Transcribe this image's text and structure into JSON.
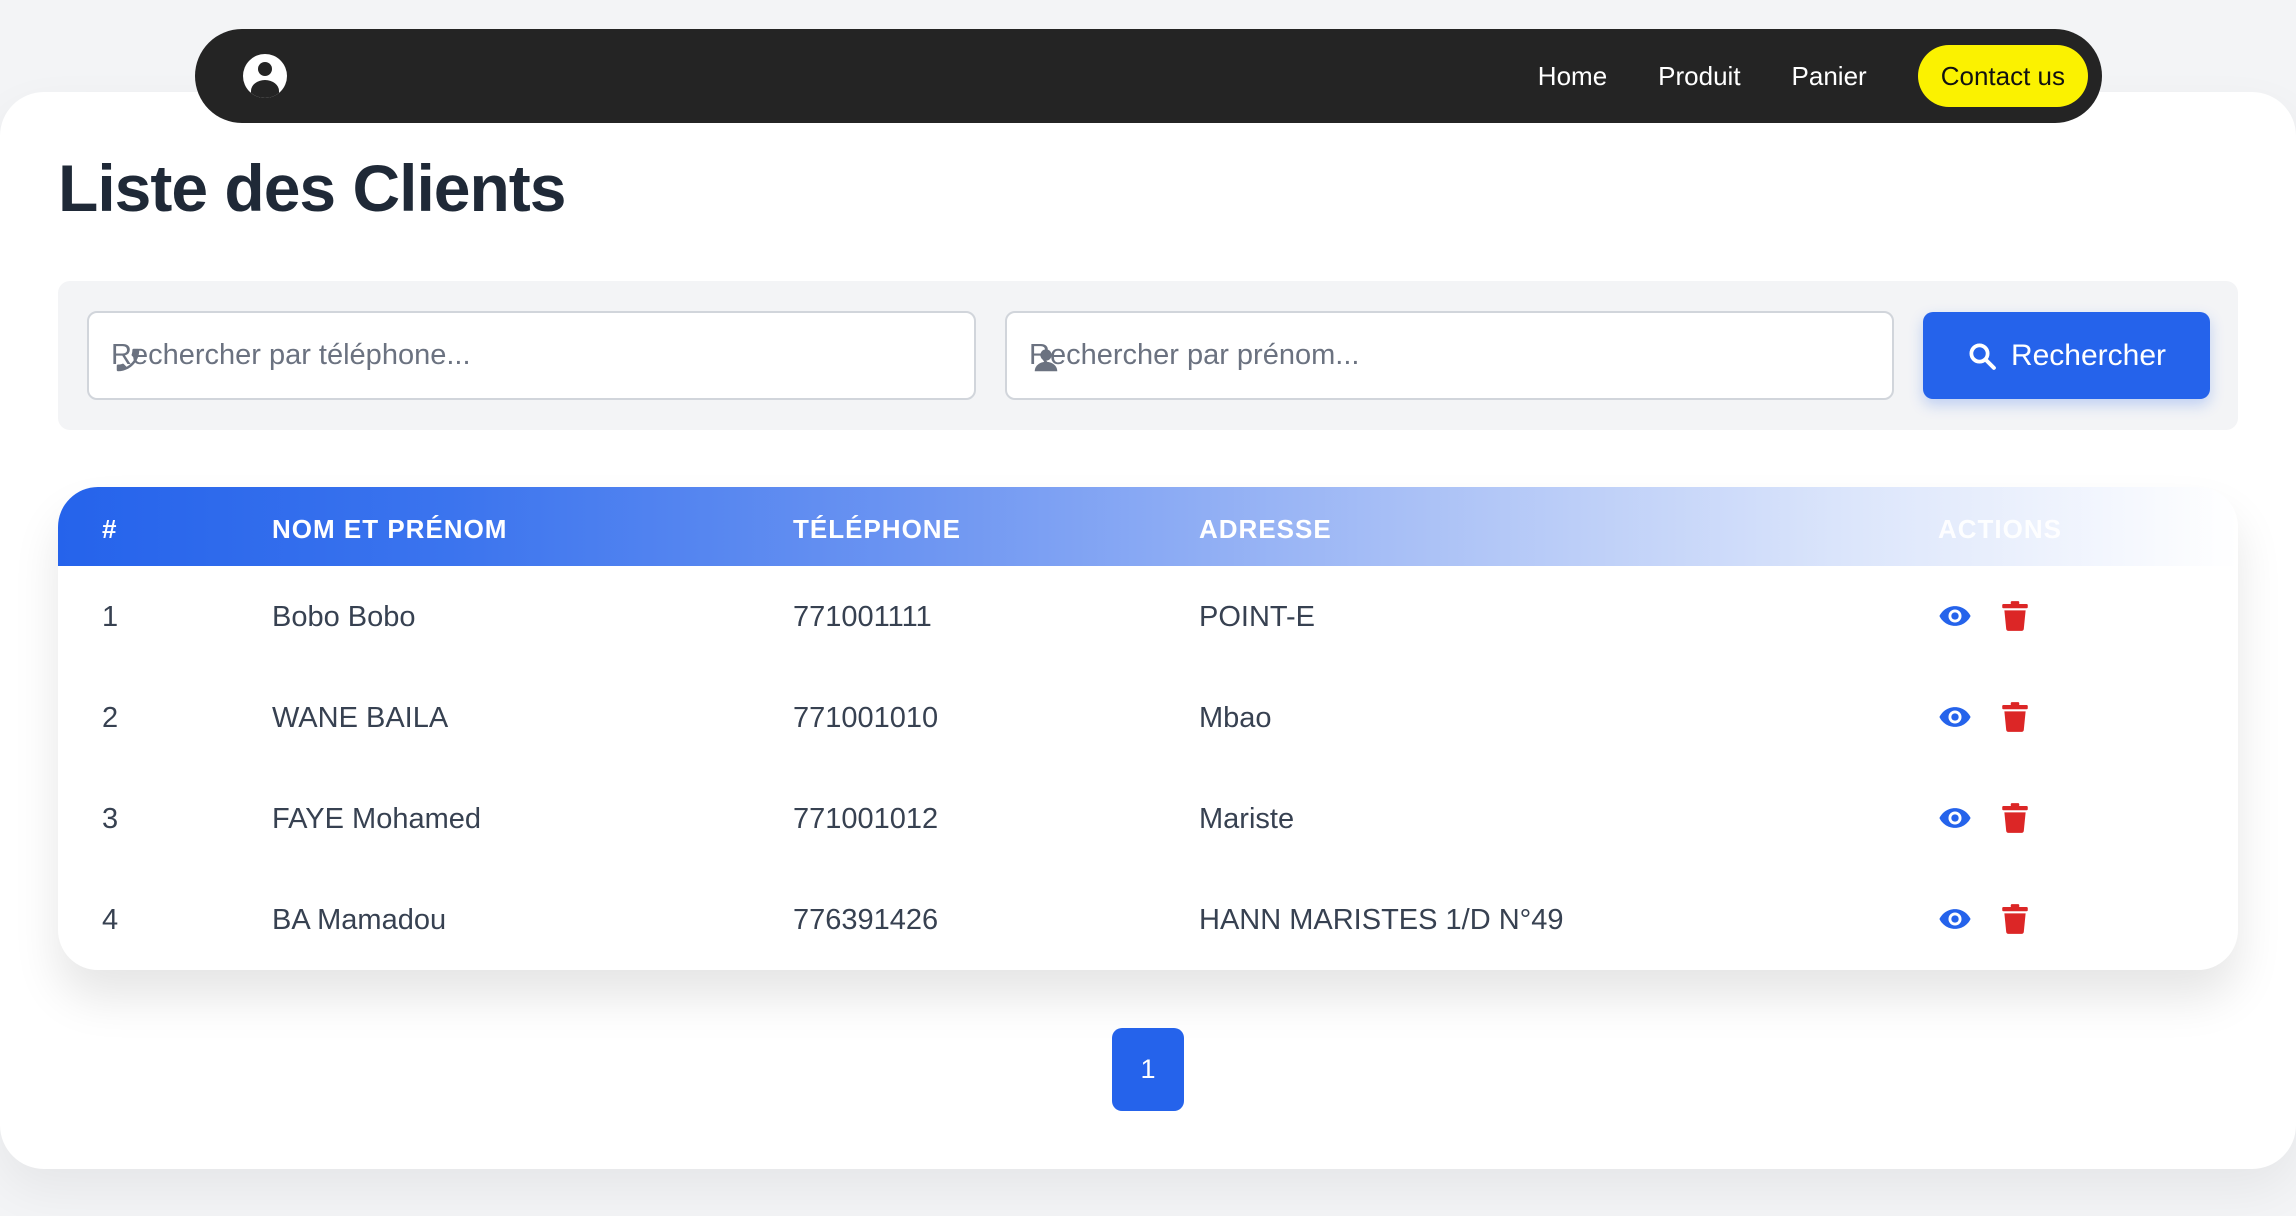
{
  "nav": {
    "links": [
      "Home",
      "Produit",
      "Panier"
    ],
    "contact_label": "Contact us",
    "contact_color": "#fbf200",
    "background": "#242424"
  },
  "page_title": "Liste des Clients",
  "search": {
    "phone_placeholder": "Rechercher par téléphone...",
    "name_placeholder": "Rechercher par prénom...",
    "button_label": "Rechercher",
    "accent": "#2563eb"
  },
  "table": {
    "headers": [
      "#",
      "NOM ET PRÉNOM",
      "TÉLÉPHONE",
      "ADRESSE",
      "ACTIONS"
    ],
    "rows": [
      {
        "id": "1",
        "name": "Bobo Bobo",
        "phone": "771001111",
        "address": "POINT-E"
      },
      {
        "id": "2",
        "name": "WANE BAILA",
        "phone": "771001010",
        "address": "Mbao"
      },
      {
        "id": "3",
        "name": "FAYE Mohamed",
        "phone": "771001012",
        "address": "Mariste"
      },
      {
        "id": "4",
        "name": "BA Mamadou",
        "phone": "776391426",
        "address": "HANN MARISTES 1/D N°49"
      }
    ],
    "action_icons": [
      "eye-icon",
      "trash-icon"
    ],
    "view_color": "#2563eb",
    "delete_color": "#dc2626"
  },
  "pagination": {
    "current_page": "1"
  }
}
